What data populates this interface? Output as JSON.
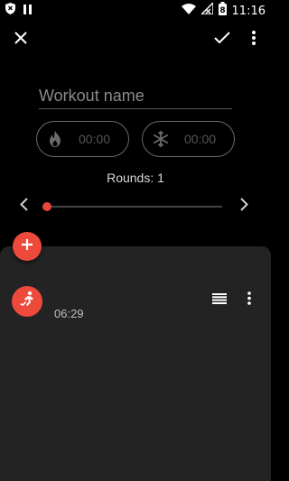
{
  "status_bar": {
    "time": "11:16",
    "battery_level": "8"
  },
  "toolbar": {
    "close_icon": "close-icon",
    "save_icon": "check-icon",
    "menu_icon": "more-vert-icon"
  },
  "workout": {
    "name_value": "",
    "name_placeholder": "Workout name",
    "warmup_time": "00:00",
    "cooldown_time": "00:00",
    "rounds_label": "Rounds: 1",
    "rounds_progress": 0
  },
  "exercises": [
    {
      "icon": "running-icon",
      "duration": "06:29"
    }
  ],
  "colors": {
    "accent": "#ee4a3c",
    "background": "#000000",
    "sheet": "#232323"
  }
}
